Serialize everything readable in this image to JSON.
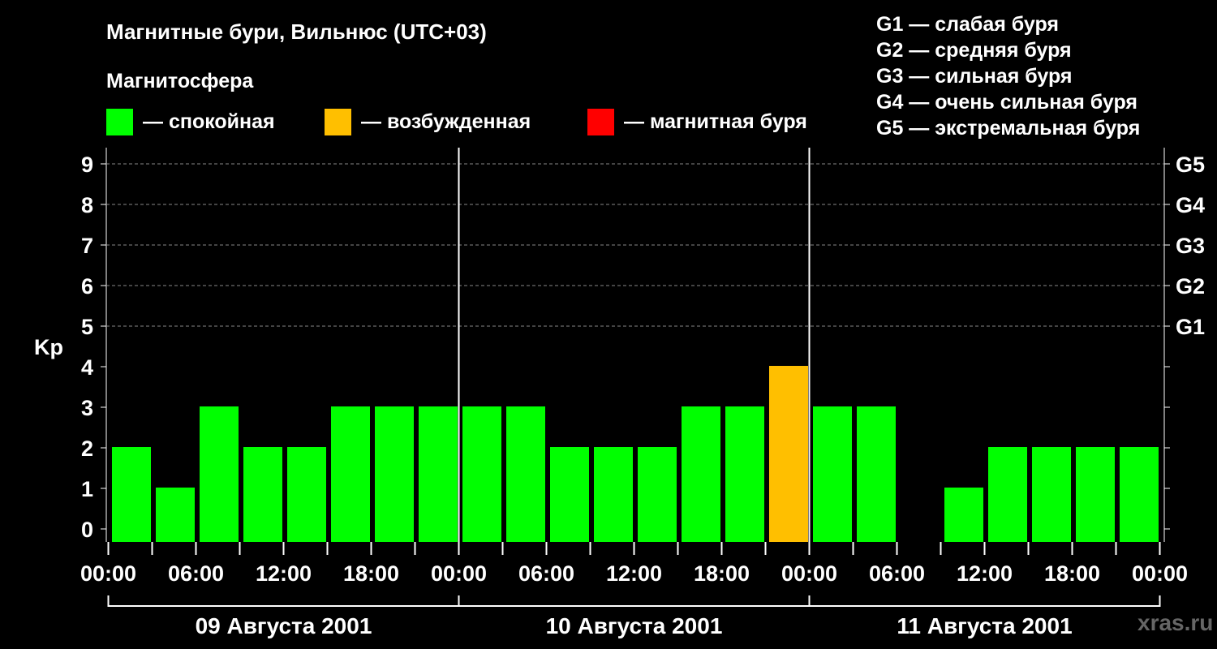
{
  "header": {
    "title": "Магнитные бури, Вильнюс (UTC+03)",
    "subtitle": "Магнитосфера"
  },
  "legend": [
    {
      "color": "#00ff00",
      "label": "— спокойная"
    },
    {
      "color": "#ffbf00",
      "label": "— возбужденная"
    },
    {
      "color": "#ff0000",
      "label": "— магнитная буря"
    }
  ],
  "g_legend": [
    "G1 — слабая буря",
    "G2 — средняя буря",
    "G3 — сильная буря",
    "G4 — очень сильная буря",
    "G5 — экстремальная буря"
  ],
  "watermark": "xras.ru",
  "chart_data": {
    "type": "bar",
    "ylabel": "Kp",
    "ylim": [
      0,
      9
    ],
    "y_ticks": [
      "0",
      "1",
      "2",
      "3",
      "4",
      "5",
      "6",
      "7",
      "8",
      "9"
    ],
    "right_ticks": [
      {
        "value": 5,
        "label": "G1"
      },
      {
        "value": 6,
        "label": "G2"
      },
      {
        "value": 7,
        "label": "G3"
      },
      {
        "value": 8,
        "label": "G4"
      },
      {
        "value": 9,
        "label": "G5"
      }
    ],
    "grid": "dashed horizontal lines at Kp 5–9",
    "x_tick_labels": [
      "00:00",
      "06:00",
      "12:00",
      "18:00",
      "00:00",
      "06:00",
      "12:00",
      "18:00",
      "00:00",
      "06:00",
      "12:00",
      "18:00",
      "00:00"
    ],
    "days": [
      "09 Августа 2001",
      "10 Августа 2001",
      "11 Августа 2001"
    ],
    "bar_interval_hours": 3,
    "values": [
      2,
      1,
      3,
      2,
      2,
      3,
      3,
      3,
      3,
      3,
      2,
      2,
      2,
      3,
      3,
      4,
      3,
      3,
      0,
      1,
      2,
      2,
      2,
      2
    ],
    "colors": {
      "quiet": "#00ff00",
      "disturbed": "#ffbf00",
      "storm": "#ff0000"
    }
  }
}
